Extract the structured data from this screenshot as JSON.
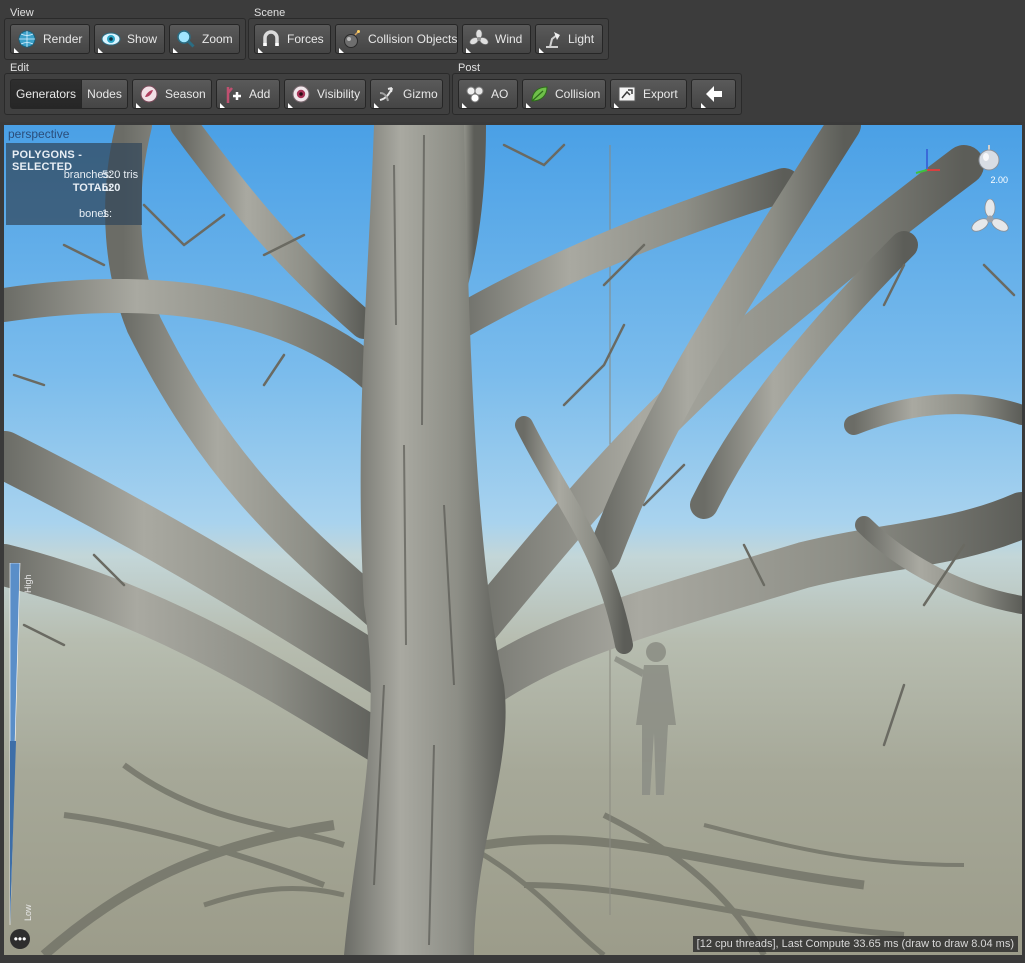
{
  "toolbar": {
    "view": {
      "title": "View",
      "buttons": [
        {
          "label": "Render",
          "icon": "globe-icon"
        },
        {
          "label": "Show",
          "icon": "eye-icon"
        },
        {
          "label": "Zoom",
          "icon": "magnifier-icon"
        }
      ]
    },
    "scene": {
      "title": "Scene",
      "buttons": [
        {
          "label": "Forces",
          "icon": "magnet-icon"
        },
        {
          "label": "Collision Objects",
          "icon": "bomb-icon"
        },
        {
          "label": "Wind",
          "icon": "fan-icon"
        },
        {
          "label": "Light",
          "icon": "lamp-icon"
        }
      ]
    },
    "edit": {
      "title": "Edit",
      "buttons": [
        {
          "label": "Generators",
          "active": true
        },
        {
          "label": "Nodes"
        },
        {
          "label": "Season",
          "icon": "season-icon"
        },
        {
          "label": "Add",
          "icon": "add-icon"
        },
        {
          "label": "Visibility",
          "icon": "eyeball-icon"
        },
        {
          "label": "Gizmo",
          "icon": "gizmo-icon"
        }
      ]
    },
    "post": {
      "title": "Post",
      "buttons": [
        {
          "label": "AO",
          "icon": "spheres-icon"
        },
        {
          "label": "Collision",
          "icon": "leaf-icon"
        },
        {
          "label": "Export",
          "icon": "export-icon"
        },
        {
          "label": "",
          "icon": "back-arrow-icon"
        }
      ]
    }
  },
  "viewport": {
    "camera": "perspective",
    "stats": {
      "title": "POLYGONS - SELECTED",
      "branches_label": "branches:",
      "branches_value": "520 tris",
      "total_label": "TOTAL:",
      "total_value": "520",
      "bones_label": "bones:",
      "bones_value": "1"
    },
    "gauge": {
      "high_label": "High",
      "low_label": "Low"
    },
    "zoom_value": "2.00",
    "status": "[12 cpu threads], Last Compute 33.65 ms (draw to draw 8.04 ms)",
    "more_label": "•••"
  },
  "colors": {
    "sky": "#4aa0e6",
    "ground": "#a6a898",
    "bark": "#8c8c84",
    "toolbar": "#3c3c3c"
  }
}
